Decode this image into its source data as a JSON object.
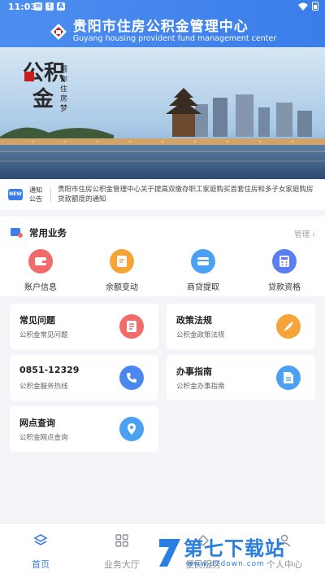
{
  "status": {
    "time": "11:03",
    "icons": [
      "mail-icon",
      "alert-icon",
      "app-icon"
    ]
  },
  "header": {
    "title_cn": "贵阳市住房公积金管理中心",
    "title_en": "Guyang housing provident fund management center"
  },
  "hero": {
    "caption_lines": [
      "公积金",
      "圆你住房梦"
    ]
  },
  "notice": {
    "badge": "NEW",
    "label": "通知公告",
    "text": "贵阳市住房公积金管理中心关于提高双缴存职工家庭购买首套住房和多子女家庭购房贷款额度的通知"
  },
  "business": {
    "title": "常用业务",
    "manage": "管理",
    "items": [
      {
        "label": "账户信息",
        "icon": "wallet-icon",
        "color": "#f26b6b"
      },
      {
        "label": "余额变动",
        "icon": "balance-icon",
        "color": "#f6a43a"
      },
      {
        "label": "商贷提取",
        "icon": "card-icon",
        "color": "#4aa0f2"
      },
      {
        "label": "贷款资格",
        "icon": "calculator-icon",
        "color": "#5b7ff0"
      }
    ]
  },
  "cards": [
    {
      "title": "常见问题",
      "subtitle": "公积金常见问题",
      "icon": "faq-icon",
      "color": "#f26b6b"
    },
    {
      "title": "政策法规",
      "subtitle": "公积金政策法规",
      "icon": "policy-icon",
      "color": "#f6a43a"
    },
    {
      "title": "0851-12329",
      "subtitle": "公积金服务热线",
      "icon": "phone-icon",
      "color": "#4a88f0"
    },
    {
      "title": "办事指南",
      "subtitle": "公积金办事指南",
      "icon": "guide-icon",
      "color": "#4aa0f2"
    },
    {
      "title": "网点查询",
      "subtitle": "公积金网点查询",
      "icon": "location-icon",
      "color": "#4aa0f2"
    }
  ],
  "nav": {
    "tabs": [
      {
        "label": "首页",
        "icon": "home-layers-icon",
        "active": true
      },
      {
        "label": "业务大厅",
        "icon": "grid-icon",
        "active": false
      },
      {
        "label": "便民服务",
        "icon": "service-icon",
        "active": false
      },
      {
        "label": "个人中心",
        "icon": "user-icon",
        "active": false
      }
    ]
  },
  "watermark": {
    "text": "第七下载站",
    "url": "www.d7down.com"
  },
  "colors": {
    "primary": "#3b7de9",
    "background": "#f3f5f9"
  }
}
